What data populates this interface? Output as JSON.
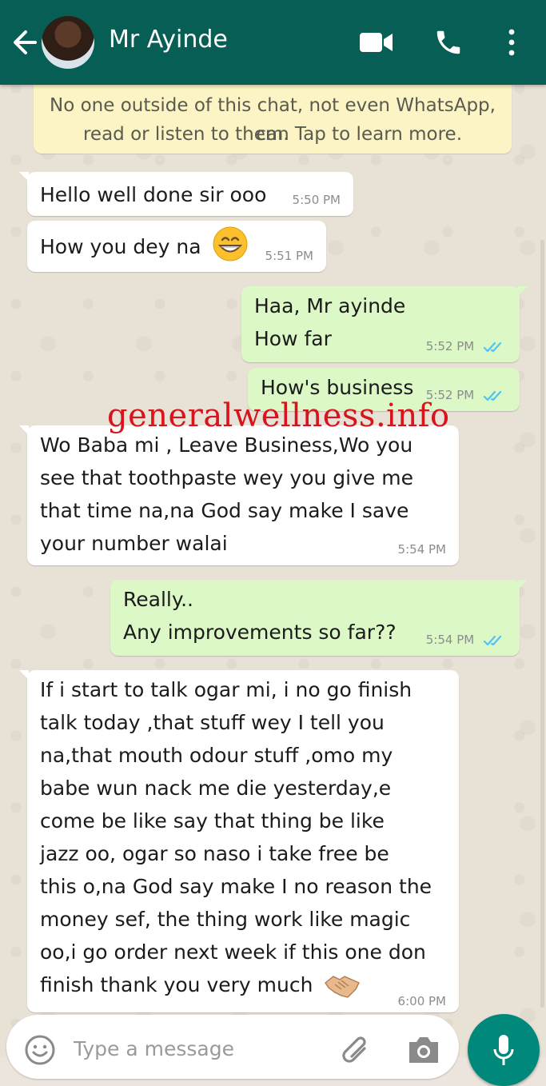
{
  "header": {
    "contact_name": "Mr Ayinde",
    "icons": [
      "back-arrow-icon",
      "video-call-icon",
      "phone-icon",
      "more-vert-icon"
    ]
  },
  "notice": {
    "line1": "No one outside of this chat, not even WhatsApp, can",
    "line2": "read or listen to them. Tap to learn more."
  },
  "messages": [
    {
      "direction": "in",
      "lines": [
        "Hello well done sir ooo"
      ],
      "time": "5:50 PM"
    },
    {
      "direction": "in",
      "lines": [
        "How you dey na"
      ],
      "time": "5:51 PM",
      "emoji": "grinning-face-icon"
    },
    {
      "direction": "out",
      "lines": [
        "Haa, Mr ayinde",
        "How far"
      ],
      "time": "5:52 PM",
      "status": "read"
    },
    {
      "direction": "out",
      "lines": [
        "How's business"
      ],
      "time": "5:52 PM",
      "status": "read"
    },
    {
      "direction": "in",
      "lines": [
        "Wo Baba mi , Leave Business,Wo you",
        "see that toothpaste wey you give me",
        "that time na,na God say make I save",
        "your number walai"
      ],
      "time": "5:54 PM"
    },
    {
      "direction": "out",
      "lines": [
        "Really..",
        "Any improvements so far??"
      ],
      "time": "5:54 PM",
      "status": "read"
    },
    {
      "direction": "in",
      "lines": [
        "If i start to talk ogar mi, i no go finish",
        "talk today ,that stuff wey I tell you",
        "na,that mouth odour stuff ,omo my",
        "babe wun nack me die yesterday,e",
        "come be like say that thing be like",
        "jazz oo, ogar so naso i take free be",
        "this o,na God say make I no reason the",
        "money sef, the thing work like magic",
        "oo,i go order next week if this one don",
        "finish thank you very much"
      ],
      "time": "6:00 PM",
      "emoji": "handshake-icon"
    }
  ],
  "watermark": "generalwellness.info",
  "input": {
    "placeholder": "Type a message"
  },
  "colors": {
    "header": "#075e54",
    "outgoing_bubble": "#dcf8c6",
    "incoming_bubble": "#ffffff",
    "notice_bg": "#fcf4c5",
    "read_ticks": "#4fc3f7",
    "mic_button": "#00897b",
    "watermark": "#d7131b"
  }
}
